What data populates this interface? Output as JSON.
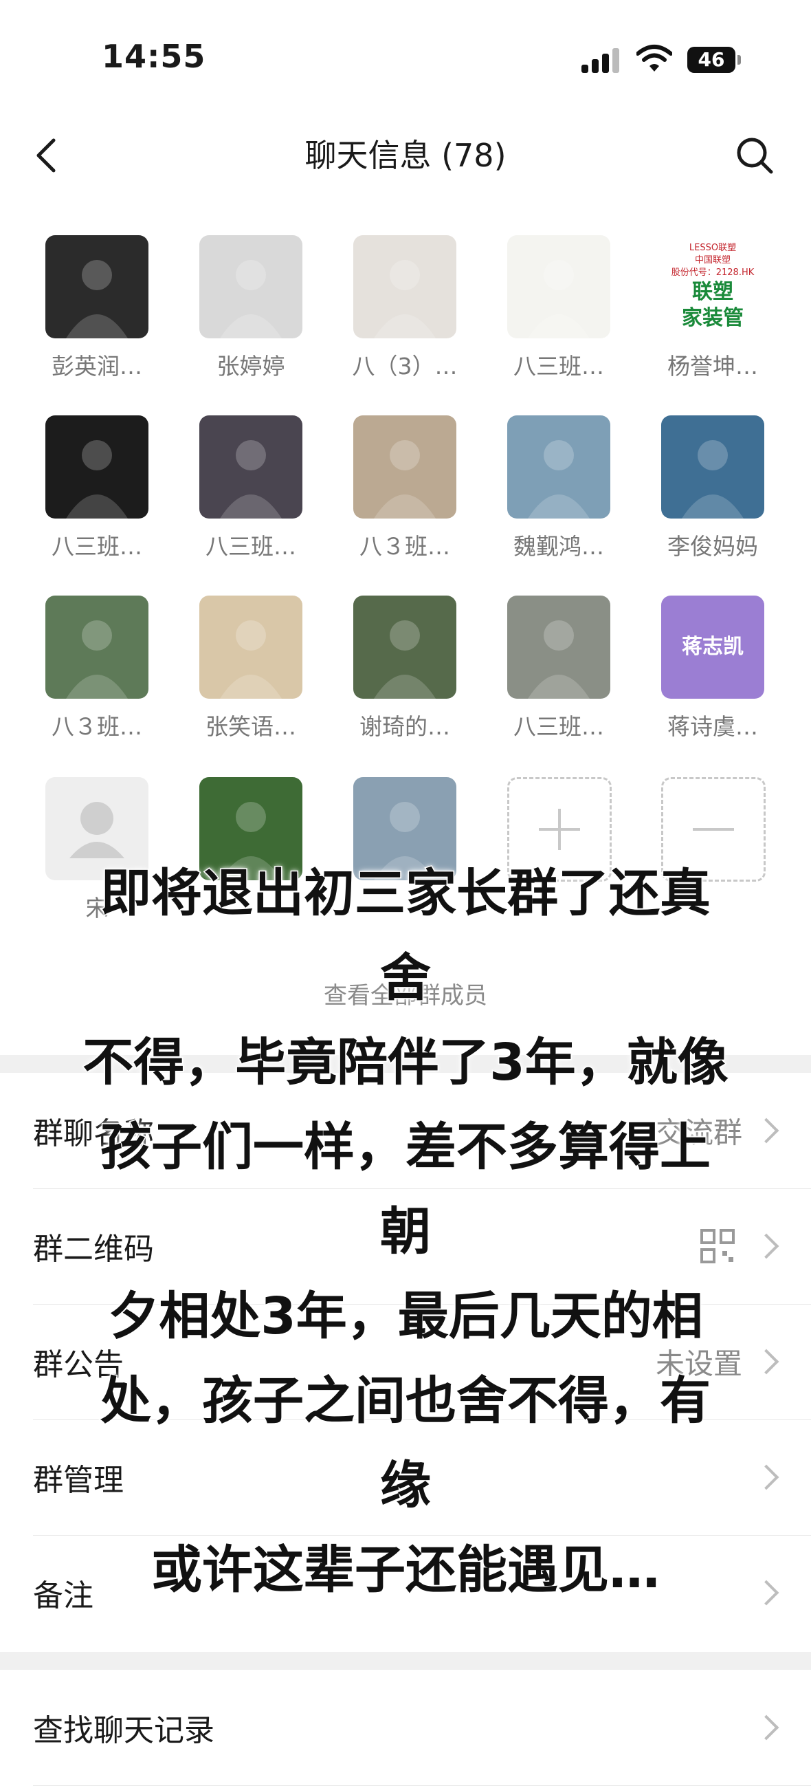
{
  "status_bar": {
    "time": "14:55",
    "battery": "46"
  },
  "nav": {
    "title": "聊天信息 (78)"
  },
  "members": [
    {
      "name": "彭英润…",
      "bg": "#2b2b2b"
    },
    {
      "name": "张婷婷",
      "bg": "#d9d9d9"
    },
    {
      "name": "八（3）…",
      "bg": "#e5e1dc"
    },
    {
      "name": "八三班…",
      "bg": "#f4f4f0"
    },
    {
      "name": "杨誉坤…",
      "bg": "#ffffff",
      "logo_text": [
        "LESSO联塑",
        "中国联塑",
        "股份代号：2128.HK",
        "联塑",
        "家装管"
      ]
    },
    {
      "name": "八三班…",
      "bg": "#1c1c1c"
    },
    {
      "name": "八三班…",
      "bg": "#4a4550"
    },
    {
      "name": "八３班…",
      "bg": "#bba992"
    },
    {
      "name": "魏觐鸿…",
      "bg": "#7e9fb6"
    },
    {
      "name": "李俊妈妈",
      "bg": "#3f6f94"
    },
    {
      "name": "八３班…",
      "bg": "#5e7a58"
    },
    {
      "name": "张笑语…",
      "bg": "#d9c7a8"
    },
    {
      "name": "谢琦的…",
      "bg": "#566a4b"
    },
    {
      "name": "八三班…",
      "bg": "#8a8f86"
    },
    {
      "name": "蒋诗虞…",
      "bg": "#9b7ed3",
      "logo_text": [
        "蒋志凯"
      ]
    },
    {
      "name": "宋",
      "bg": "#eeeeee"
    },
    {
      "name": "",
      "bg": "#3e6b35"
    },
    {
      "name": "",
      "bg": "#8aa0b2"
    }
  ],
  "view_all": "查看全部群成员",
  "settings": [
    {
      "label": "群聊名称",
      "value": "…交流群"
    },
    {
      "label": "群二维码",
      "value": ""
    },
    {
      "label": "群公告",
      "value": "未设置"
    },
    {
      "label": "群管理",
      "value": ""
    },
    {
      "label": "备注",
      "value": ""
    },
    {
      "label": "查找聊天记录",
      "value": ""
    }
  ],
  "caption": [
    "即将退出初三家长群了还真舍",
    "不得，毕竟陪伴了3年，就像",
    "孩子们一样，差不多算得上朝",
    "夕相处3年，最后几天的相",
    "处，孩子之间也舍不得，有缘",
    "或许这辈子还能遇见…"
  ]
}
